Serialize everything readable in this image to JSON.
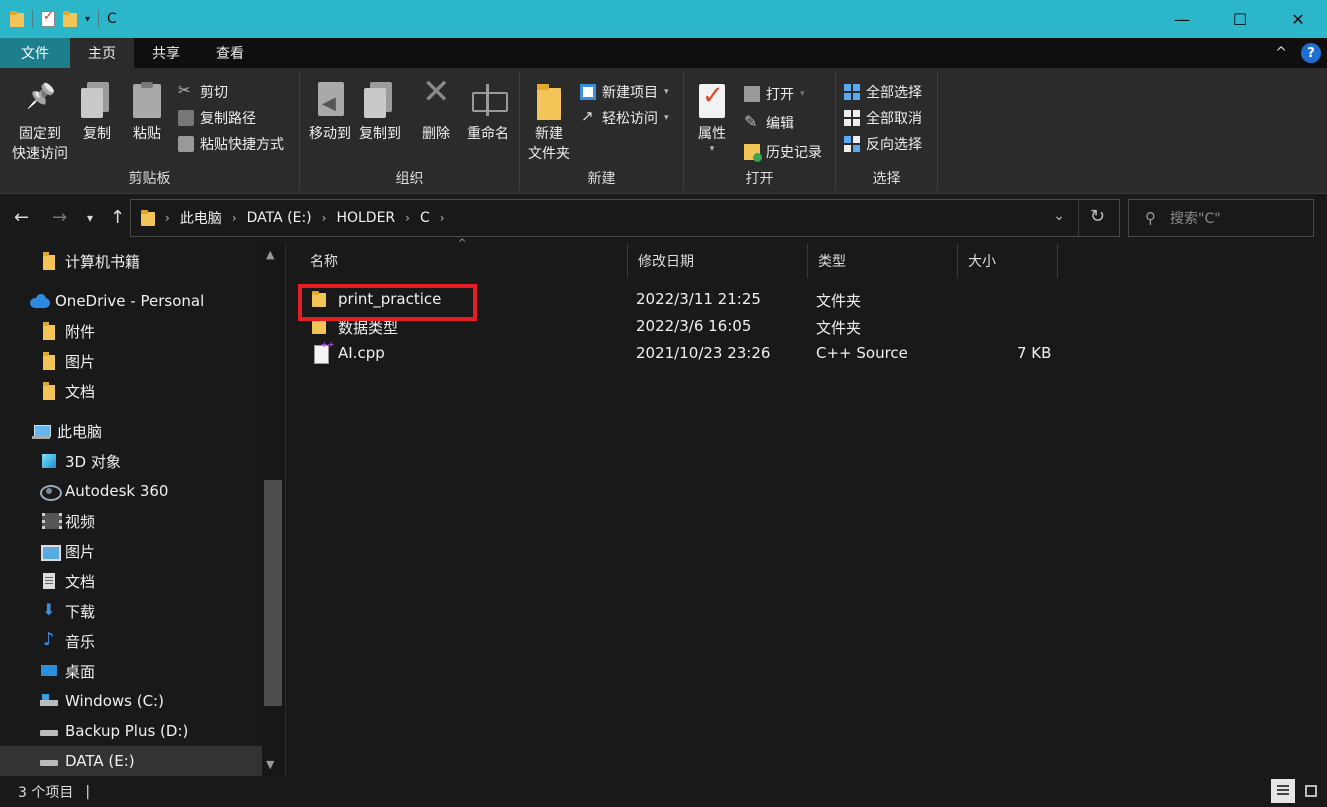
{
  "window": {
    "title": "C",
    "controls": {
      "minimize": "—",
      "maximize": "☐",
      "close": "✕"
    }
  },
  "ribbon_tabs": {
    "file": "文件",
    "home": "主页",
    "share": "共享",
    "view": "查看",
    "help": "?",
    "collapse": "^"
  },
  "ribbon": {
    "clipboard": {
      "label": "剪贴板",
      "pin_line1": "固定到",
      "pin_line2": "快速访问",
      "copy": "复制",
      "paste": "粘贴",
      "cut": "剪切",
      "copy_path": "复制路径",
      "paste_shortcut": "粘贴快捷方式"
    },
    "organize": {
      "label": "组织",
      "move_to": "移动到",
      "copy_to": "复制到",
      "delete": "删除",
      "rename": "重命名"
    },
    "new": {
      "label": "新建",
      "new_folder_line1": "新建",
      "new_folder_line2": "文件夹",
      "new_item": "新建项目",
      "easy_access": "轻松访问"
    },
    "open": {
      "label": "打开",
      "properties": "属性",
      "open": "打开",
      "edit": "编辑",
      "history": "历史记录"
    },
    "select": {
      "label": "选择",
      "select_all": "全部选择",
      "select_none": "全部取消",
      "invert": "反向选择"
    }
  },
  "address": {
    "crumbs": [
      "此电脑",
      "DATA (E:)",
      "HOLDER",
      "C"
    ],
    "search_placeholder": "搜索\"C\""
  },
  "sidebar": {
    "items": [
      {
        "label": "计算机书籍",
        "icon": "folder-icon"
      },
      {
        "label": "OneDrive - Personal",
        "icon": "onedrive-icon"
      },
      {
        "label": "附件",
        "icon": "folder-icon"
      },
      {
        "label": "图片",
        "icon": "folder-icon"
      },
      {
        "label": "文档",
        "icon": "folder-icon"
      },
      {
        "label": "此电脑",
        "icon": "this-pc-icon"
      },
      {
        "label": "3D 对象",
        "icon": "3d-objects-icon"
      },
      {
        "label": "Autodesk 360",
        "icon": "autodesk-icon"
      },
      {
        "label": "视频",
        "icon": "videos-icon"
      },
      {
        "label": "图片",
        "icon": "pictures-icon"
      },
      {
        "label": "文档",
        "icon": "documents-icon"
      },
      {
        "label": "下载",
        "icon": "downloads-icon"
      },
      {
        "label": "音乐",
        "icon": "music-icon"
      },
      {
        "label": "桌面",
        "icon": "desktop-icon"
      },
      {
        "label": "Windows (C:)",
        "icon": "windows-drive-icon"
      },
      {
        "label": "Backup Plus (D:)",
        "icon": "drive-icon"
      },
      {
        "label": "DATA (E:)",
        "icon": "drive-icon"
      }
    ]
  },
  "columns": {
    "name": "名称",
    "modified": "修改日期",
    "type": "类型",
    "size": "大小"
  },
  "files": [
    {
      "name": "print_practice",
      "modified": "2022/3/11 21:25",
      "type": "文件夹",
      "size": ""
    },
    {
      "name": "数据类型",
      "modified": "2022/3/6 16:05",
      "type": "文件夹",
      "size": ""
    },
    {
      "name": "AI.cpp",
      "modified": "2021/10/23 23:26",
      "type": "C++ Source",
      "size": "7 KB"
    }
  ],
  "status": {
    "count": "3 个项目",
    "sep": "|"
  },
  "colors": {
    "titlebar": "#2bb6c9",
    "file_tab": "#1d7f8c",
    "highlight": "#e51d25",
    "background": "#191919"
  }
}
